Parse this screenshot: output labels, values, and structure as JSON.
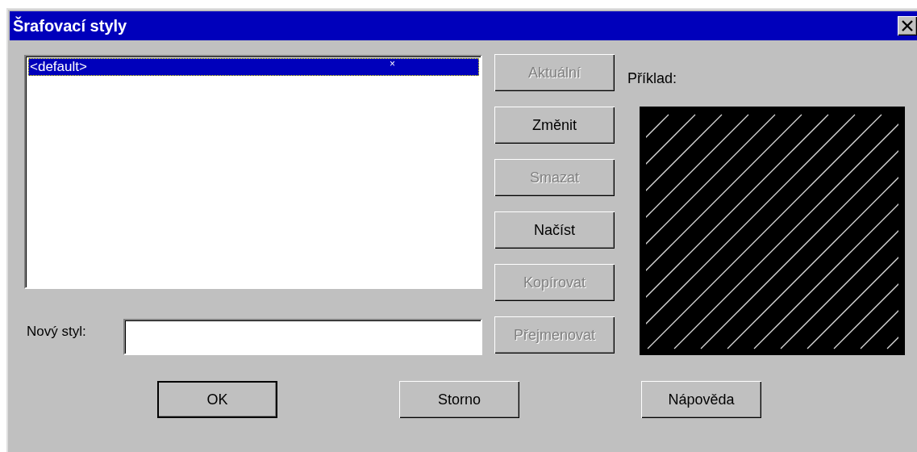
{
  "window": {
    "title": "Šrafovací styly"
  },
  "styles_list": {
    "items": [
      {
        "label": "<default>",
        "mark": "×",
        "selected": true
      }
    ]
  },
  "action_buttons": [
    {
      "label": "Aktuální",
      "disabled": true
    },
    {
      "label": "Změnit",
      "disabled": false
    },
    {
      "label": "Smazat",
      "disabled": true
    },
    {
      "label": "Načíst",
      "disabled": false
    },
    {
      "label": "Kopírovat",
      "disabled": true
    },
    {
      "label": "Přejmenovat",
      "disabled": true
    }
  ],
  "new_style": {
    "label": "Nový styl:"
  },
  "preview": {
    "label": "Příklad:"
  },
  "dialog_buttons": [
    {
      "label": "OK",
      "default": true
    },
    {
      "label": "Storno",
      "default": false
    },
    {
      "label": "Nápověda",
      "default": false
    }
  ]
}
